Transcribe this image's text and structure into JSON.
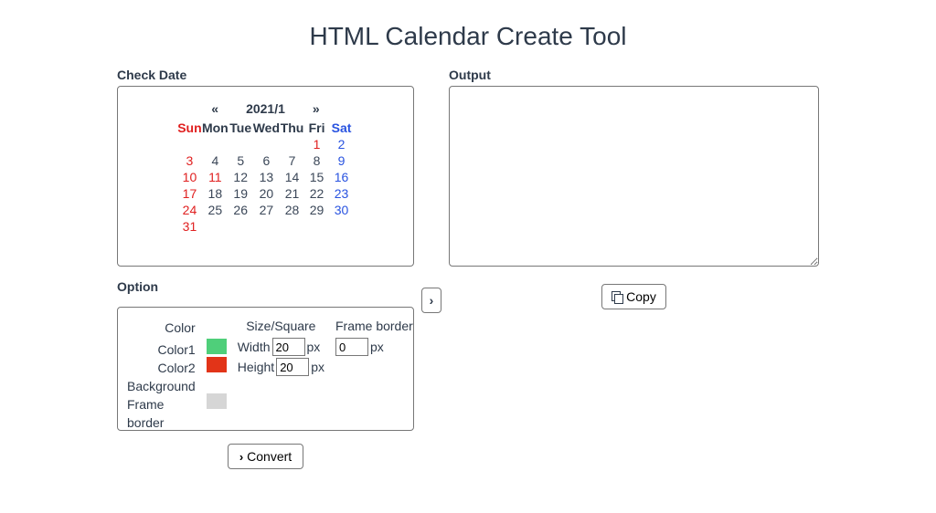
{
  "title": "HTML Calendar Create Tool",
  "checkDate": {
    "label": "Check Date",
    "prev": "«",
    "month": "2021/1",
    "next": "»",
    "dow": [
      "Sun",
      "Mon",
      "Tue",
      "Wed",
      "Thu",
      "Fri",
      "Sat"
    ],
    "weeks": [
      [
        null,
        null,
        null,
        null,
        null,
        {
          "d": "1",
          "t": "hol"
        },
        {
          "d": "2",
          "t": "sat"
        }
      ],
      [
        {
          "d": "3",
          "t": "sun"
        },
        {
          "d": "4",
          "t": "n"
        },
        {
          "d": "5",
          "t": "n"
        },
        {
          "d": "6",
          "t": "n"
        },
        {
          "d": "7",
          "t": "n"
        },
        {
          "d": "8",
          "t": "n"
        },
        {
          "d": "9",
          "t": "sat"
        }
      ],
      [
        {
          "d": "10",
          "t": "sun"
        },
        {
          "d": "11",
          "t": "hol"
        },
        {
          "d": "12",
          "t": "n"
        },
        {
          "d": "13",
          "t": "n"
        },
        {
          "d": "14",
          "t": "n"
        },
        {
          "d": "15",
          "t": "n"
        },
        {
          "d": "16",
          "t": "sat"
        }
      ],
      [
        {
          "d": "17",
          "t": "sun"
        },
        {
          "d": "18",
          "t": "n"
        },
        {
          "d": "19",
          "t": "n"
        },
        {
          "d": "20",
          "t": "n"
        },
        {
          "d": "21",
          "t": "n"
        },
        {
          "d": "22",
          "t": "n"
        },
        {
          "d": "23",
          "t": "sat"
        }
      ],
      [
        {
          "d": "24",
          "t": "sun"
        },
        {
          "d": "25",
          "t": "n"
        },
        {
          "d": "26",
          "t": "n"
        },
        {
          "d": "27",
          "t": "n"
        },
        {
          "d": "28",
          "t": "n"
        },
        {
          "d": "29",
          "t": "n"
        },
        {
          "d": "30",
          "t": "sat"
        }
      ],
      [
        {
          "d": "31",
          "t": "sun"
        },
        null,
        null,
        null,
        null,
        null,
        null
      ]
    ]
  },
  "arrow": "›",
  "output": {
    "label": "Output",
    "value": "",
    "copy": "Copy"
  },
  "option": {
    "label": "Option",
    "colorHead": "Color",
    "sizeHead": "Size/Square",
    "frameHead": "Frame border",
    "rows": {
      "color1": "Color1",
      "color2": "Color2",
      "background": "Background",
      "frameBorder": "Frame border"
    },
    "swatches": {
      "color1": "#4fcf7a",
      "color2": "#e23418",
      "background": "#ffffff",
      "frameBorder": "#d6d6d6"
    },
    "widthLabel": "Width",
    "heightLabel": "Height",
    "widthValue": "20",
    "heightValue": "20",
    "frameValue": "0",
    "px": "px"
  },
  "convert": "Convert"
}
